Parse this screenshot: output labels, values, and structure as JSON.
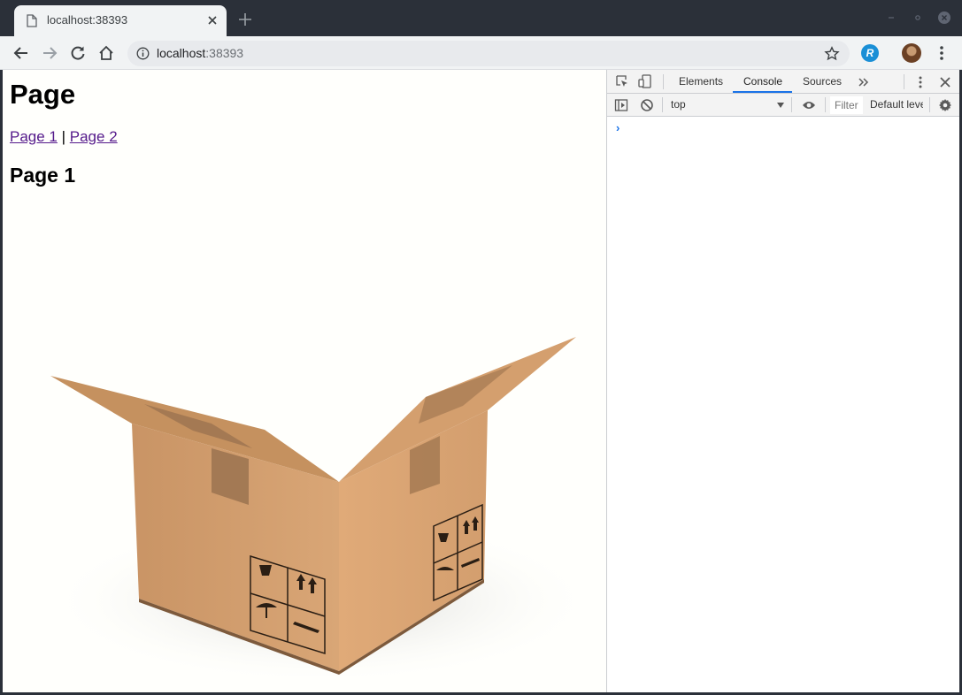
{
  "browser": {
    "tab_title": "localhost:38393",
    "url_host": "localhost",
    "url_port": ":38393",
    "extension_letter": "R"
  },
  "page": {
    "heading": "Page",
    "nav": {
      "link1": "Page 1",
      "separator": " | ",
      "link2": "Page 2"
    },
    "subheading": "Page 1",
    "image_alt": "cardboard-box"
  },
  "devtools": {
    "tabs": [
      "Elements",
      "Console",
      "Sources"
    ],
    "active_tab": "Console",
    "context": "top",
    "filter_placeholder": "Filter",
    "levels": "Default levels",
    "prompt": "›"
  },
  "colors": {
    "chrome_dark": "#2b3039",
    "toolbar": "#f1f3f4",
    "link_visited": "#551a8b",
    "devtools_accent": "#1a73e8"
  }
}
